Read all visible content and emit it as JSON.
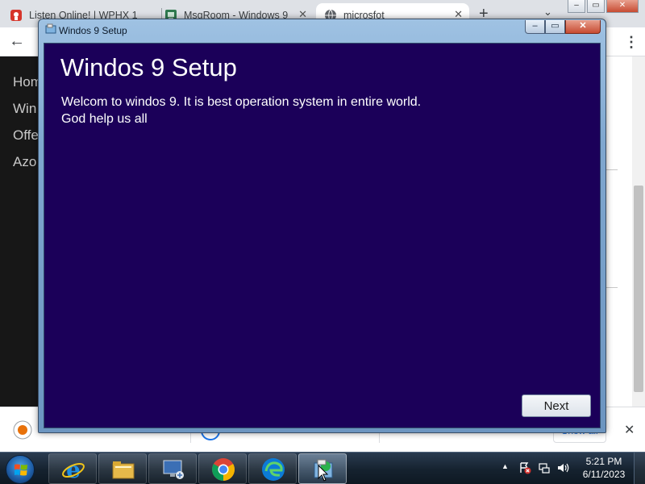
{
  "browser": {
    "tabs": [
      {
        "title": "Listen Online! | WPHX 1",
        "favicon": "radio-station-icon"
      },
      {
        "title": "MsgRoom - Windows 9",
        "favicon": "msgroom-icon"
      },
      {
        "title": "microsfot",
        "favicon": "globe-icon",
        "active": true
      }
    ],
    "new_tab": "+",
    "tab_search": "⌄",
    "window_controls": {
      "minimize": "–",
      "maximize": "▭",
      "close": "✕"
    },
    "back": "←",
    "menu": "⋮"
  },
  "page": {
    "nav_items": [
      "Hom",
      "Win",
      "Offe",
      "Azo"
    ]
  },
  "download_bar": {
    "show_all": "Show all",
    "close": "✕"
  },
  "dialog": {
    "title": "Windos 9 Setup",
    "heading": "Windos 9 Setup",
    "lines": [
      "Welcom to windos 9. It is best operation system in entire world.",
      "God help us all"
    ],
    "next_label": "Next",
    "controls": {
      "minimize": "–",
      "maximize": "▭",
      "close": "✕"
    },
    "colors": {
      "client_background": "#1b0059",
      "frame": "#7fa7cf"
    }
  },
  "taskbar": {
    "pinned": [
      "internet-explorer-icon",
      "file-explorer-icon",
      "remote-desktop-icon",
      "chrome-icon",
      "edge-icon",
      "setup-app-icon"
    ],
    "tray": {
      "expand": "▲"
    },
    "clock": {
      "time": "5:21 PM",
      "date": "6/11/2023"
    }
  }
}
